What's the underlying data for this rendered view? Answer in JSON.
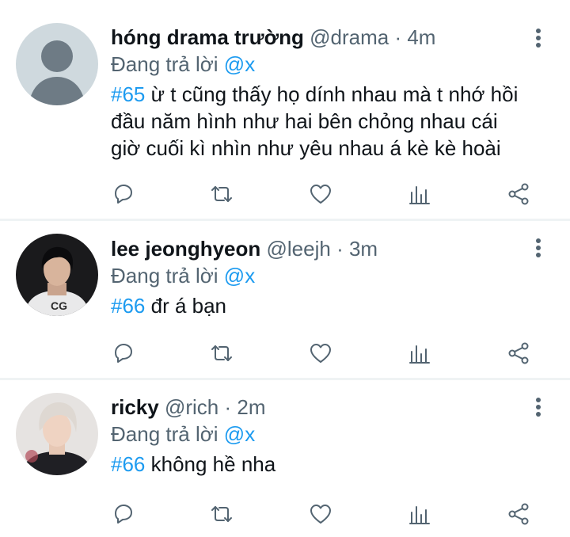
{
  "tweets": [
    {
      "name": "hóng drama trường",
      "handle": "@drama",
      "dot": "·",
      "time": "4m",
      "reply_prefix": "Đang trả lời",
      "reply_to": "@x",
      "hashtag": "#65",
      "text": " ừ t cũng thấy họ dính nhau mà t nhớ hồi đầu năm hình như hai bên chỏng nhau cái giờ cuối kì nhìn như yêu nhau á kè kè hoài",
      "avatar": "default-avatar"
    },
    {
      "name": "lee jeonghyeon",
      "handle": "@leejh",
      "dot": "·",
      "time": "3m",
      "reply_prefix": "Đang trả lời",
      "reply_to": "@x",
      "hashtag": "#66",
      "text": " đr á bạn",
      "avatar": "photo-avatar-dark-hair"
    },
    {
      "name": "ricky",
      "handle": "@rich",
      "dot": "·",
      "time": "2m",
      "reply_prefix": "Đang trả lời",
      "reply_to": "@x",
      "hashtag": "#66",
      "text": " không hề nha",
      "avatar": "photo-avatar-blond-hair"
    }
  ],
  "icons": {
    "reply": "reply-icon",
    "retweet": "retweet-icon",
    "like": "like-icon",
    "views": "views-icon",
    "share": "share-icon",
    "more": "more-icon"
  },
  "colors": {
    "accent": "#1d9bf0",
    "secondary_text": "#536471",
    "primary_text": "#0f1419",
    "divider": "#eff3f4"
  }
}
